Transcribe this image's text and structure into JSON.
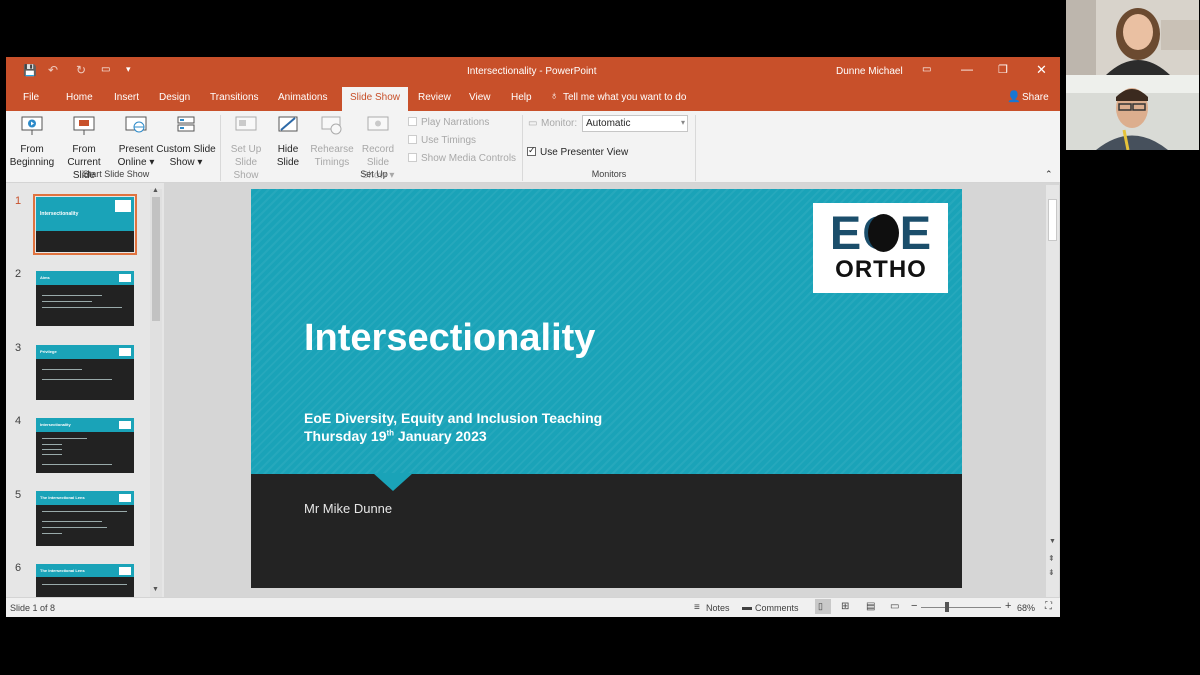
{
  "window": {
    "title": "Intersectionality  -  PowerPoint",
    "user": "Dunne Michael"
  },
  "tabs": [
    "File",
    "Home",
    "Insert",
    "Design",
    "Transitions",
    "Animations",
    "Slide Show",
    "Review",
    "View",
    "Help"
  ],
  "tell_me": "Tell me what you want to do",
  "share": "Share",
  "ribbon": {
    "from_beginning": [
      "From",
      "Beginning"
    ],
    "from_current": [
      "From",
      "Current Slide"
    ],
    "present_online": [
      "Present",
      "Online ▾"
    ],
    "custom_show": [
      "Custom Slide",
      "Show ▾"
    ],
    "group_start": "Start Slide Show",
    "setup_show": [
      "Set Up",
      "Slide Show"
    ],
    "hide_slide": [
      "Hide",
      "Slide"
    ],
    "rehearse": [
      "Rehearse",
      "Timings"
    ],
    "record": [
      "Record Slide",
      "Show ▾"
    ],
    "play_narrations": "Play Narrations",
    "use_timings": "Use Timings",
    "show_media": "Show Media Controls",
    "group_setup": "Set Up",
    "monitor_label": "Monitor:",
    "monitor_value": "Automatic",
    "presenter_view": "Use Presenter View",
    "group_monitors": "Monitors"
  },
  "thumbnails": [
    {
      "num": "1",
      "title": "Intersectionality"
    },
    {
      "num": "2",
      "title": "Aims"
    },
    {
      "num": "3",
      "title": "Privilege"
    },
    {
      "num": "4",
      "title": "Intersectionality"
    },
    {
      "num": "5",
      "title": "The Intersectional Lens"
    },
    {
      "num": "6",
      "title": "The Intersectional Lens"
    }
  ],
  "slide": {
    "title": "Intersectionality",
    "subtitle1": "EoE Diversity, Equity and Inclusion Teaching",
    "subtitle2_pre": "Thursday 19",
    "subtitle2_sup": "th",
    "subtitle2_post": " January 2023",
    "presenter": "Mr Mike Dunne",
    "logo_top": "EOE",
    "logo_bottom": "ORTHO"
  },
  "status": {
    "slide_counter": "Slide 1 of 8",
    "notes": "Notes",
    "comments": "Comments",
    "zoom": "68%"
  },
  "colors": {
    "accent": "#c8502a",
    "slide_teal": "#1aa3b8",
    "slide_dark": "#232323",
    "logo_navy": "#1b4e6b"
  }
}
